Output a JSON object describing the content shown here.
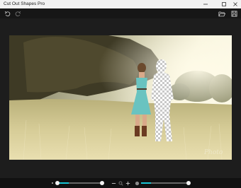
{
  "window": {
    "title": "Cut Out Shapes Pro"
  },
  "toolbar": {
    "undo_icon": "undo-icon",
    "redo_icon": "redo-icon",
    "open_icon": "folder-open-icon",
    "save_icon": "save-icon"
  },
  "image": {
    "description_icon": "photo-canvas"
  },
  "bottombar": {
    "brush_size_level": 0.27,
    "zoom_level": 0.05,
    "opacity_level": 0.21
  },
  "colors": {
    "accent": "#19c6d6",
    "toolbar_bg": "#161616",
    "canvas_bg": "#1d1d1d",
    "titlebar_bg": "#f2f2f2"
  }
}
